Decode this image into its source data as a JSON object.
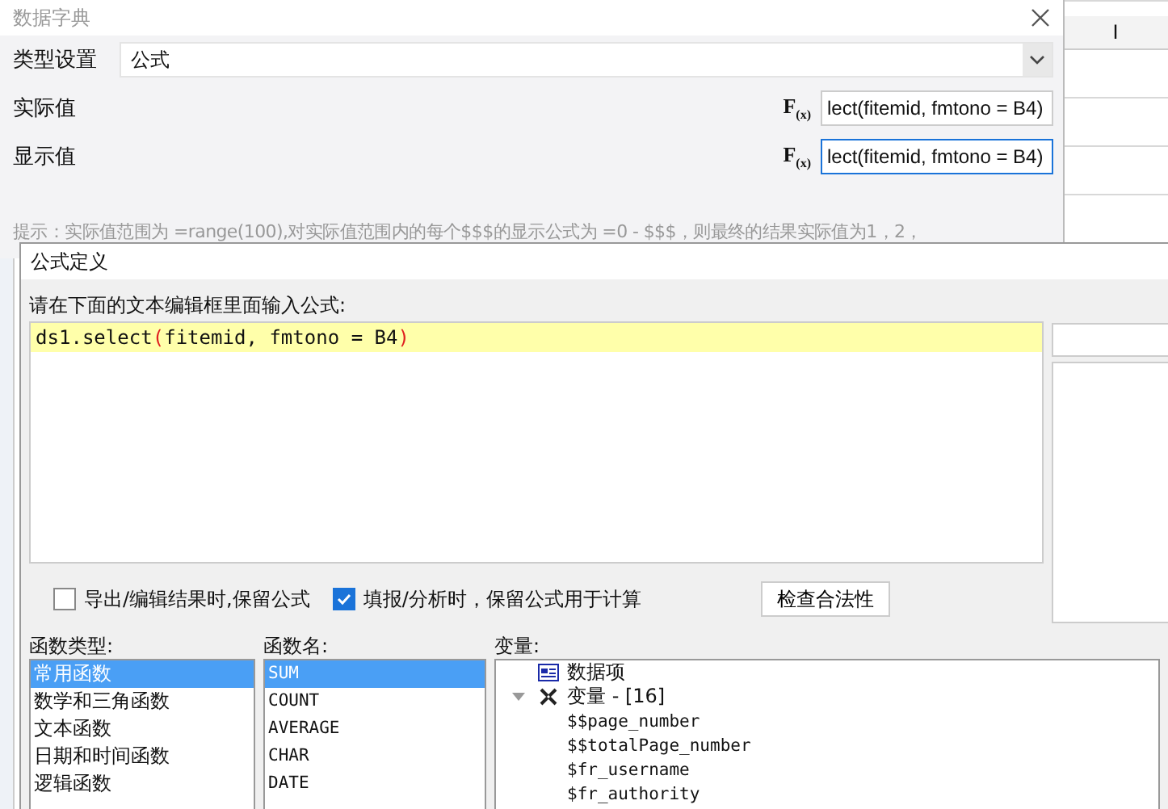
{
  "sheet": {
    "column_header": "I"
  },
  "dict_dialog": {
    "title": "数据字典",
    "type_setting": {
      "label": "类型设置",
      "value": "公式"
    },
    "rows": [
      {
        "label": "实际值",
        "formula_icon": "F$_{(x)}$",
        "value": "lect(fitemid, fmtono = B4)",
        "focused": false
      },
      {
        "label": "显示值",
        "formula_icon": "F$_{(x)}$",
        "value": "lect(fitemid, fmtono = B4)",
        "focused": true
      }
    ],
    "hint": "提示：实际值范围为 =range(100),对实际值范围内的每个$$$的显示公式为 =0 - $$$，则最终的结果实际值为1，2，"
  },
  "formula_dialog": {
    "title": "公式定义",
    "prompt": "请在下面的文本编辑框里面输入公式:",
    "formula": "ds1.select(fitemid, fmtono = B4)",
    "options": [
      {
        "label": "导出/编辑结果时,保留公式",
        "checked": false
      },
      {
        "label": "填报/分析时，保留公式用于计算",
        "checked": true
      }
    ],
    "check_button": "检查合法性",
    "function_types": {
      "label": "函数类型:",
      "items": [
        {
          "label": "常用函数",
          "selected": true
        },
        {
          "label": "数学和三角函数",
          "selected": false
        },
        {
          "label": "文本函数",
          "selected": false
        },
        {
          "label": "日期和时间函数",
          "selected": false
        },
        {
          "label": "逻辑函数",
          "selected": false
        }
      ]
    },
    "function_names": {
      "label": "函数名:",
      "items": [
        {
          "label": "SUM",
          "selected": true
        },
        {
          "label": "COUNT",
          "selected": false
        },
        {
          "label": "AVERAGE",
          "selected": false
        },
        {
          "label": "CHAR",
          "selected": false
        },
        {
          "label": "DATE",
          "selected": false
        }
      ]
    },
    "variables": {
      "label": "变量:",
      "tree": [
        {
          "label": "数据项",
          "kind": "data"
        },
        {
          "label": "变量 - [16]",
          "kind": "vars",
          "expanded": true,
          "children": [
            {
              "label": "$$page_number"
            },
            {
              "label": "$$totalPage_number"
            },
            {
              "label": "$fr_username"
            },
            {
              "label": "$fr_authority"
            }
          ]
        }
      ]
    }
  }
}
